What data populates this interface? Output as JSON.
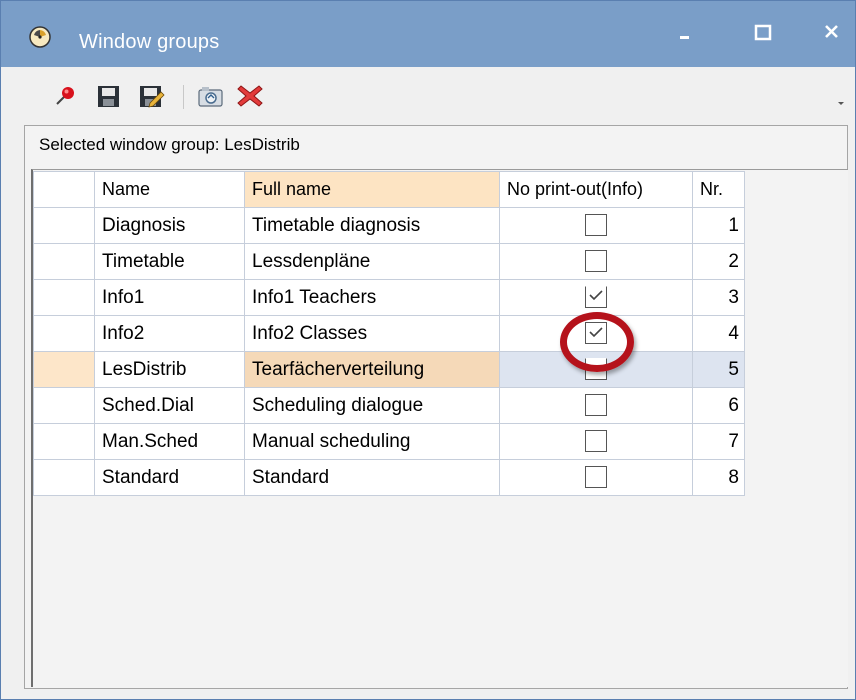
{
  "window": {
    "title": "Window groups",
    "title_icon": "clock-icon",
    "controls": [
      "minimize-icon",
      "maximize-icon",
      "close-icon"
    ]
  },
  "toolbar": {
    "items": [
      "pin-icon",
      "save-icon",
      "save-as-icon",
      "camera-icon",
      "delete-icon"
    ],
    "overflow_icon": "chevron-down-icon"
  },
  "panel": {
    "selected_label": "Selected window group: LesDistrib"
  },
  "grid": {
    "headers": {
      "name": "Name",
      "full_name": "Full name",
      "no_print": "No print-out(Info)",
      "nr": "Nr."
    },
    "rows": [
      {
        "name": "Diagnosis",
        "full_name": "Timetable diagnosis",
        "no_print": false,
        "nr": "1"
      },
      {
        "name": "Timetable",
        "full_name": "Lessdenpläne",
        "no_print": false,
        "nr": "2"
      },
      {
        "name": "Info1",
        "full_name": "Info1 Teachers",
        "no_print": true,
        "nr": "3"
      },
      {
        "name": "Info2",
        "full_name": "Info2 Classes",
        "no_print": true,
        "nr": "4"
      },
      {
        "name": "LesDistrib",
        "full_name": "Tearfächerverteilung",
        "no_print": false,
        "nr": "5"
      },
      {
        "name": "Sched.Dial",
        "full_name": "Scheduling dialogue",
        "no_print": false,
        "nr": "6"
      },
      {
        "name": "Man.Sched",
        "full_name": "Manual scheduling",
        "no_print": false,
        "nr": "7"
      },
      {
        "name": "Standard",
        "full_name": "Standard",
        "no_print": false,
        "nr": "8"
      }
    ],
    "selected_row": "LesDistrib"
  },
  "colors": {
    "titlebar": "#7a9ec8",
    "selected_cell": "#f5d9b8",
    "header_highlight": "#fde4c3",
    "annotation_ring": "#b5121b"
  }
}
